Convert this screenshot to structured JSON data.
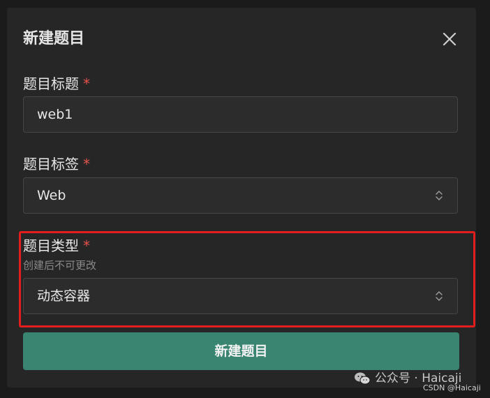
{
  "dialog": {
    "title": "新建题目",
    "close_icon": "close-icon"
  },
  "fields": {
    "title": {
      "label": "题目标题",
      "required_mark": "*",
      "value": "web1"
    },
    "tag": {
      "label": "题目标签",
      "required_mark": "*",
      "value": "Web",
      "icon": "chevron-updown-icon"
    },
    "type": {
      "label": "题目类型",
      "required_mark": "*",
      "hint": "创建后不可更改",
      "value": "动态容器",
      "icon": "chevron-updown-icon"
    }
  },
  "submit_label": "新建题目",
  "watermark": {
    "text": "公众号 · Haicaji",
    "icon": "wechat-icon",
    "csdn": "CSDN @Haicaji"
  },
  "colors": {
    "accent": "#3a8572",
    "required": "#e5534b",
    "highlight": "#e21d1d"
  }
}
